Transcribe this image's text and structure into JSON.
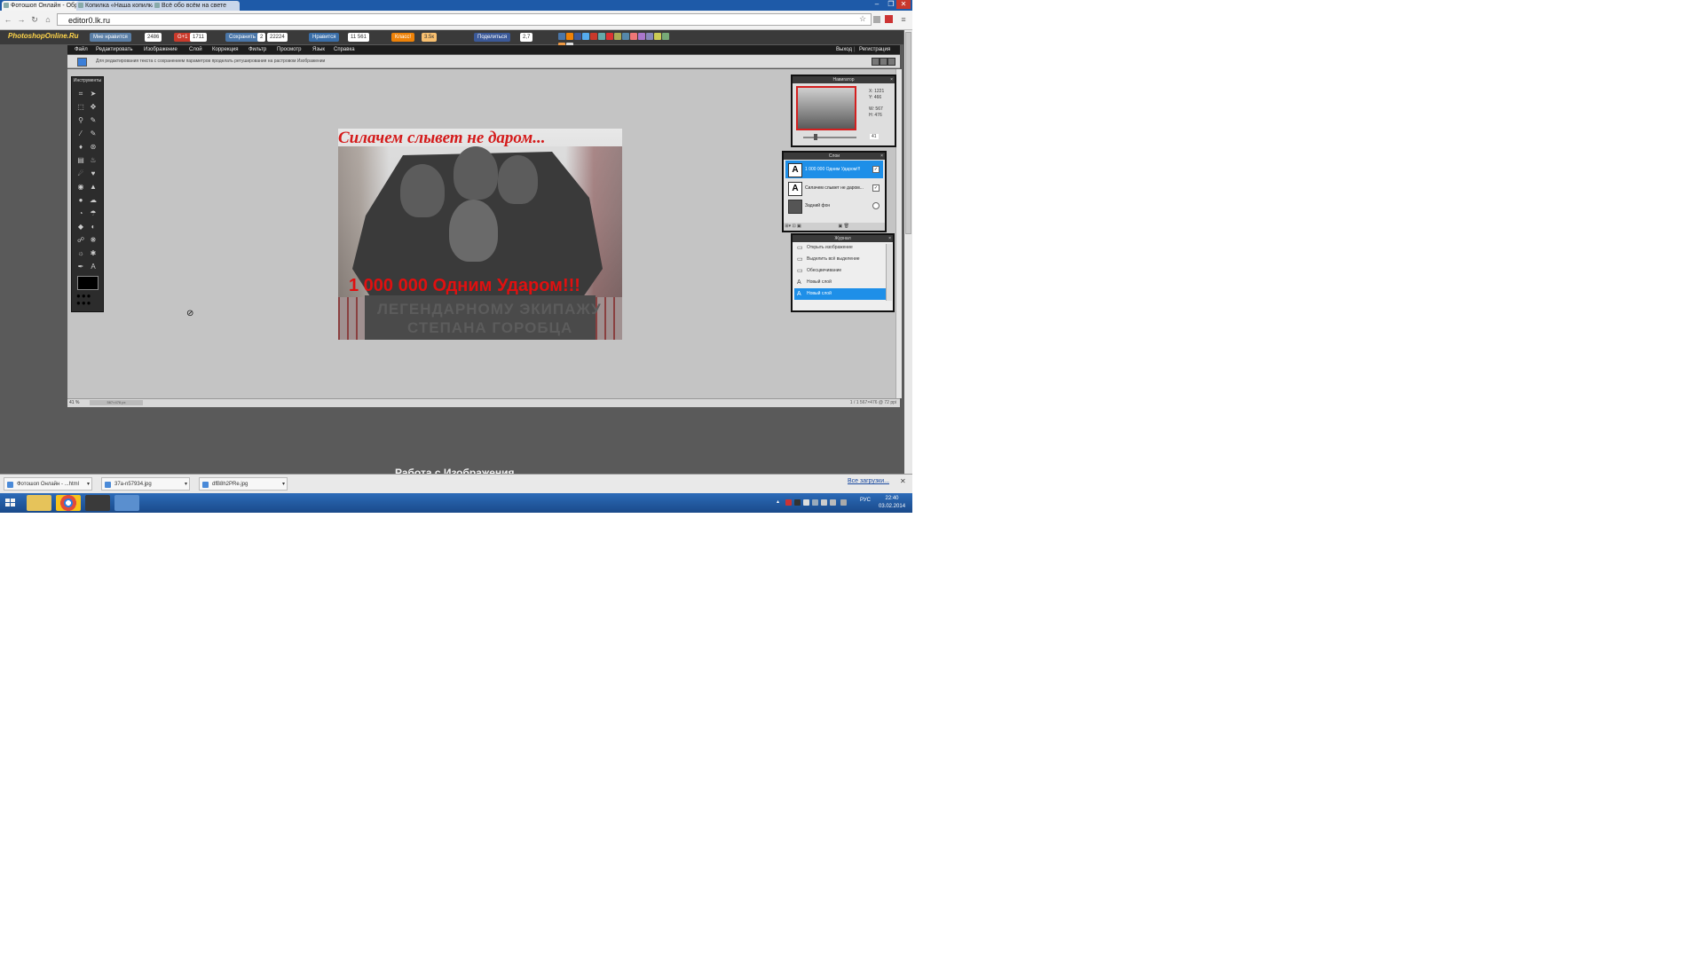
{
  "browser": {
    "tabs": [
      {
        "label": "Фотошоп Онлайн - Обра"
      },
      {
        "label": "Копилка «Наша копилка»"
      },
      {
        "label": "Всё обо всём на свете"
      }
    ],
    "url": "editor0.lk.ru",
    "window_buttons": {
      "minimize": "–",
      "restore": "❐",
      "close": "✕"
    },
    "nav": {
      "back": "←",
      "forward": "→",
      "reload": "↻",
      "home": "⌂",
      "star": "☆",
      "menu": "≡"
    }
  },
  "site": {
    "logo": "PhotoshopOnline.Ru",
    "social": [
      {
        "label": "Мне нравится",
        "count": "2486",
        "color": "#5b7fa6"
      },
      {
        "label": "G+1",
        "count": "1711",
        "color": "#c93a2b"
      },
      {
        "label": "Сохранить",
        "count": "2",
        "color": "#4a76a8"
      },
      {
        "count2": "22224"
      },
      {
        "label": "Нравится",
        "count": "11 561",
        "color": "#3a6ea8"
      },
      {
        "label": "Класс!",
        "count": "3.5к",
        "color": "#ee8208"
      },
      {
        "label": "Поделиться",
        "count": "2,7",
        "color": "#3b5998"
      }
    ],
    "share_colors": [
      "#4a76a8",
      "#ee8208",
      "#3b5998",
      "#55acee",
      "#c93a2b",
      "#6aa",
      "#d33",
      "#aa5",
      "#58a",
      "#e77",
      "#a7c",
      "#88b",
      "#cc5",
      "#7a7",
      "#e94",
      "#ddd"
    ]
  },
  "menu": {
    "items": [
      "Файл",
      "Редактировать",
      "Изображение",
      "Слой",
      "Коррекция",
      "Фильтр",
      "Просмотр",
      "Язык",
      "Справка"
    ],
    "right": [
      "Выход",
      "Регистрация"
    ]
  },
  "optionsbar": {
    "text": "Для редактирования текста с сохранением параметров проделать ретуширования на растровом Изображении"
  },
  "toolbox": {
    "title": "Инструменты",
    "tools": [
      "⌗",
      "➤",
      "⬚",
      "✥",
      "⚲",
      "✎",
      "⁄",
      "✎",
      "♦",
      "⊛",
      "▤",
      "♨",
      "☄",
      "♥",
      "◉",
      "▲",
      "●",
      "☁",
      "◔",
      "☂",
      "◆",
      "◐",
      "☍",
      "❋",
      "☼",
      "✱",
      "✒",
      "A",
      "☺",
      "⚲"
    ]
  },
  "canvas": {
    "caption_top": "Силачем слывет не даром...",
    "caption_main": "1 000 000 Одним Ударом!!!",
    "engraving_line1": "ЛЕГЕНДАРНОМУ ЭКИПАЖУ",
    "engraving_line2": "СТЕПАНА ГОРОБЦА"
  },
  "navigator": {
    "title": "Навигатор",
    "x": "X: 1221",
    "y": "Y: 466",
    "w": "W: 567",
    "h": "H: 476",
    "zoom": "41"
  },
  "layers": {
    "title": "Слои",
    "items": [
      {
        "name": "1 000 000 Одним Ударом!!!",
        "type": "text",
        "selected": true,
        "visible": true
      },
      {
        "name": "Силачем слывет не даром...",
        "type": "text",
        "selected": false,
        "visible": true
      },
      {
        "name": "Задний фон",
        "type": "image",
        "selected": false,
        "visible": false
      }
    ]
  },
  "journal": {
    "title": "Журнал",
    "items": [
      {
        "label": "Открыть изображение",
        "selected": false
      },
      {
        "label": "Выделить всё выделение",
        "selected": false
      },
      {
        "label": "Обесцвечивание",
        "selected": false
      },
      {
        "label": "Новый слой",
        "selected": false
      },
      {
        "label": "Новый слой",
        "selected": true
      }
    ]
  },
  "statusbar": {
    "zoom": "41 %",
    "slot": "567×476 px",
    "info": "1 / 1   567×476 @ 72 ppi"
  },
  "below_app_text": "Работа с Изображения",
  "downloads": {
    "items": [
      {
        "label": "Фотошоп Онлайн - ...html"
      },
      {
        "label": "37a-n57934.jpg"
      },
      {
        "label": "dfB8h2PRe.jpg"
      }
    ],
    "show_all": "Все загрузки...",
    "close": "✕"
  },
  "taskbar": {
    "language": "РУС",
    "time": "22:40",
    "date": "03.02.2014"
  }
}
